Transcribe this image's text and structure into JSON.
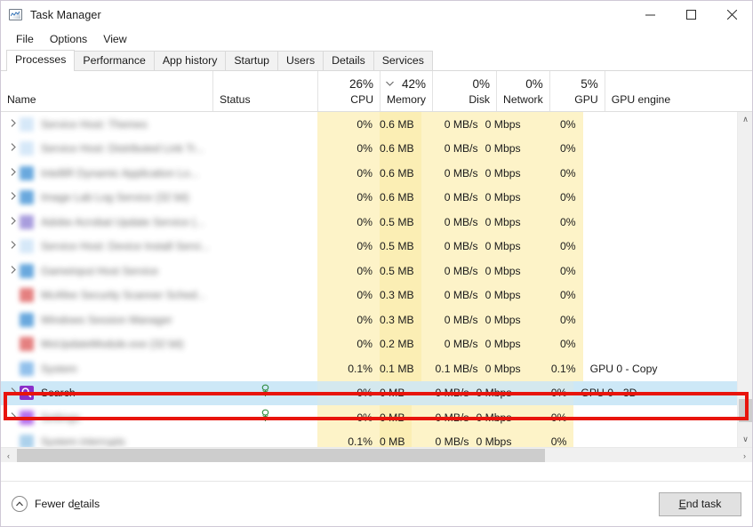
{
  "window": {
    "title": "Task Manager",
    "icon": "task-manager-icon",
    "controls": {
      "minimize": "—",
      "maximize": "□",
      "close": "✕"
    }
  },
  "menu": {
    "items": [
      "File",
      "Options",
      "View"
    ]
  },
  "tabs": {
    "active": "Processes",
    "items": [
      "Processes",
      "Performance",
      "App history",
      "Startup",
      "Users",
      "Details",
      "Services"
    ]
  },
  "columns": [
    {
      "key": "name",
      "label": "Name",
      "pct": "",
      "type": "txt",
      "sorted": false
    },
    {
      "key": "status",
      "label": "Status",
      "pct": "",
      "type": "txt",
      "sorted": false
    },
    {
      "key": "cpu",
      "label": "CPU",
      "pct": "26%",
      "type": "num",
      "sorted": false
    },
    {
      "key": "memory",
      "label": "Memory",
      "pct": "42%",
      "type": "num",
      "sorted": true
    },
    {
      "key": "disk",
      "label": "Disk",
      "pct": "0%",
      "type": "num",
      "sorted": false
    },
    {
      "key": "network",
      "label": "Network",
      "pct": "0%",
      "type": "num",
      "sorted": false
    },
    {
      "key": "gpu",
      "label": "GPU",
      "pct": "5%",
      "type": "num",
      "sorted": false
    },
    {
      "key": "engine",
      "label": "GPU engine",
      "pct": "",
      "type": "txt",
      "sorted": false
    }
  ],
  "sort_indicator": "chevron-down-icon",
  "rows": [
    {
      "name": "Service Host: Themes",
      "blurred": true,
      "expandable": true,
      "icon_color": "#cfe4f7",
      "status": "",
      "cpu": "0%",
      "memory": "0.6 MB",
      "disk": "0 MB/s",
      "network": "0 Mbps",
      "gpu": "0%",
      "engine": ""
    },
    {
      "name": "Service Host: Distributed Link Tr...",
      "blurred": true,
      "expandable": true,
      "icon_color": "#cfe4f7",
      "status": "",
      "cpu": "0%",
      "memory": "0.6 MB",
      "disk": "0 MB/s",
      "network": "0 Mbps",
      "gpu": "0%",
      "engine": ""
    },
    {
      "name": "IntelliR Dynamic Application Lo...",
      "blurred": true,
      "expandable": true,
      "icon_color": "#4f9ad8",
      "status": "",
      "cpu": "0%",
      "memory": "0.6 MB",
      "disk": "0 MB/s",
      "network": "0 Mbps",
      "gpu": "0%",
      "engine": ""
    },
    {
      "name": "Image Lab Log Service (32 bit)",
      "blurred": true,
      "expandable": true,
      "icon_color": "#4f9ad8",
      "status": "",
      "cpu": "0%",
      "memory": "0.6 MB",
      "disk": "0 MB/s",
      "network": "0 Mbps",
      "gpu": "0%",
      "engine": ""
    },
    {
      "name": "Adobe Acrobat Update Service (...",
      "blurred": true,
      "expandable": true,
      "icon_color": "#9a8cd8",
      "status": "",
      "cpu": "0%",
      "memory": "0.5 MB",
      "disk": "0 MB/s",
      "network": "0 Mbps",
      "gpu": "0%",
      "engine": ""
    },
    {
      "name": "Service Host: Device Install Servi...",
      "blurred": true,
      "expandable": true,
      "icon_color": "#cfe4f7",
      "status": "",
      "cpu": "0%",
      "memory": "0.5 MB",
      "disk": "0 MB/s",
      "network": "0 Mbps",
      "gpu": "0%",
      "engine": ""
    },
    {
      "name": "Gameinput Host Service",
      "blurred": true,
      "expandable": true,
      "icon_color": "#4f9ad8",
      "status": "",
      "cpu": "0%",
      "memory": "0.5 MB",
      "disk": "0 MB/s",
      "network": "0 Mbps",
      "gpu": "0%",
      "engine": ""
    },
    {
      "name": "McAfee Security Scanner Sched...",
      "blurred": true,
      "expandable": false,
      "icon_color": "#e06a6a",
      "status": "",
      "cpu": "0%",
      "memory": "0.3 MB",
      "disk": "0 MB/s",
      "network": "0 Mbps",
      "gpu": "0%",
      "engine": ""
    },
    {
      "name": "Windows Session Manager",
      "blurred": true,
      "expandable": false,
      "icon_color": "#4f9ad8",
      "status": "",
      "cpu": "0%",
      "memory": "0.3 MB",
      "disk": "0 MB/s",
      "network": "0 Mbps",
      "gpu": "0%",
      "engine": ""
    },
    {
      "name": "MoUpdateModule.exe (32 bit)",
      "blurred": true,
      "expandable": false,
      "icon_color": "#e06a6a",
      "status": "",
      "cpu": "0%",
      "memory": "0.2 MB",
      "disk": "0 MB/s",
      "network": "0 Mbps",
      "gpu": "0%",
      "engine": ""
    },
    {
      "name": "System",
      "blurred": true,
      "expandable": false,
      "icon_color": "#7fb6e8",
      "status": "",
      "cpu": "0.1%",
      "memory": "0.1 MB",
      "disk": "0.1 MB/s",
      "network": "0 Mbps",
      "gpu": "0.1%",
      "engine": "GPU 0 - Copy"
    },
    {
      "name": "Search",
      "blurred": false,
      "expandable": true,
      "icon_color": "#8b2fc9",
      "icon": "search-icon",
      "selected": true,
      "status": "leaf-icon",
      "cpu": "0%",
      "memory": "0 MB",
      "disk": "0 MB/s",
      "network": "0 Mbps",
      "gpu": "0%",
      "engine": "GPU 0 - 3D"
    },
    {
      "name": "Settings",
      "blurred": true,
      "expandable": true,
      "icon_color": "#a855e8",
      "status": "leaf-icon",
      "cpu": "0%",
      "memory": "0 MB",
      "disk": "0 MB/s",
      "network": "0 Mbps",
      "gpu": "0%",
      "engine": ""
    },
    {
      "name": "System interrupts",
      "blurred": true,
      "expandable": false,
      "icon_color": "#9ec9e8",
      "status": "",
      "cpu": "0.1%",
      "memory": "0 MB",
      "disk": "0 MB/s",
      "network": "0 Mbps",
      "gpu": "0%",
      "engine": ""
    }
  ],
  "footer": {
    "fewer_details": "Fewer details",
    "fewer_details_icon": "chevron-up-circle-icon",
    "end_task": "End task"
  },
  "scrollbars": {
    "vertical_up": "∧",
    "vertical_down": "∨",
    "horizontal_left": "‹",
    "horizontal_right": "›"
  },
  "annotation": {
    "shape": "rectangle",
    "color": "#e8140c",
    "target": "Search"
  },
  "colors": {
    "accent_selection": "#cde8f7",
    "heat_light": "#fdf3c8",
    "heat_mid": "#fbeeb4",
    "annotation_red": "#e8140c"
  }
}
